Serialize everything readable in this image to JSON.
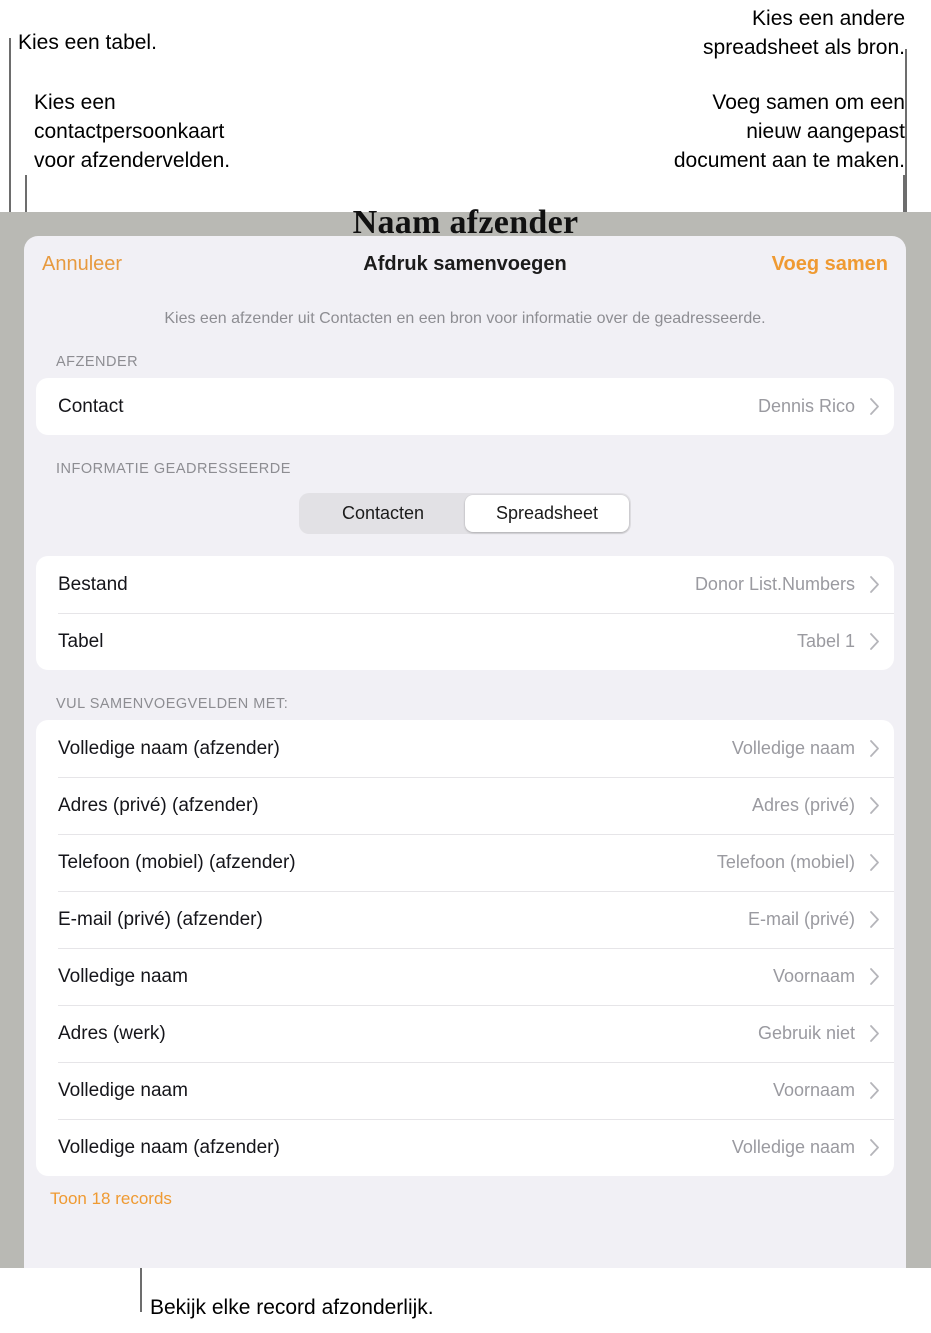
{
  "annotations": {
    "choose_table": "Kies een tabel.",
    "choose_contact_card": "Kies een\ncontactpersoonkaart\nvoor afzendervelden.",
    "choose_other_spreadsheet": "Kies een andere\nspreadsheet als bron.",
    "merge_to_create": "Voeg samen om een\nnieuw aangepast\ndocument aan te maken.",
    "view_each_record": "Bekijk elke record afzonderlijk."
  },
  "document": {
    "visible_heading": "Naam afzender"
  },
  "dialog": {
    "title": "Afdruk samenvoegen",
    "cancel_label": "Annuleer",
    "merge_label": "Voeg samen",
    "subtitle": "Kies een afzender uit Contacten en een bron voor informatie over de geadresseerde.",
    "sender_section": {
      "label": "AFZENDER",
      "rows": [
        {
          "label": "Contact",
          "value": "Dennis Rico"
        }
      ]
    },
    "recipient_section": {
      "label": "INFORMATIE GEADRESSEERDE",
      "segmented": {
        "options": [
          "Contacten",
          "Spreadsheet"
        ],
        "selected": "Spreadsheet"
      },
      "rows": [
        {
          "label": "Bestand",
          "value": "Donor List.Numbers"
        },
        {
          "label": "Tabel",
          "value": "Tabel 1"
        }
      ]
    },
    "merge_fields_section": {
      "label": "VUL SAMENVOEGVELDEN MET:",
      "rows": [
        {
          "label": "Volledige naam (afzender)",
          "value": "Volledige naam"
        },
        {
          "label": "Adres (privé) (afzender)",
          "value": "Adres (privé)"
        },
        {
          "label": "Telefoon (mobiel) (afzender)",
          "value": "Telefoon (mobiel)"
        },
        {
          "label": "E-mail (privé) (afzender)",
          "value": "E-mail (privé)"
        },
        {
          "label": "Volledige naam",
          "value": "Voornaam"
        },
        {
          "label": "Adres (werk)",
          "value": "Gebruik niet"
        },
        {
          "label": "Volledige naam",
          "value": "Voornaam"
        },
        {
          "label": "Volledige naam (afzender)",
          "value": "Volledige naam"
        }
      ]
    },
    "show_records_label": "Toon 18 records"
  },
  "colors": {
    "accent_orange": "#ef9a32",
    "sheet_background": "#f1f0f5",
    "card_background": "#ffffff",
    "document_grey": "#b9b9b4",
    "secondary_text": "#8d8d92",
    "leader_line": "#6d6d6d"
  },
  "icons": {
    "chevron_right": "chevron-right-icon"
  }
}
